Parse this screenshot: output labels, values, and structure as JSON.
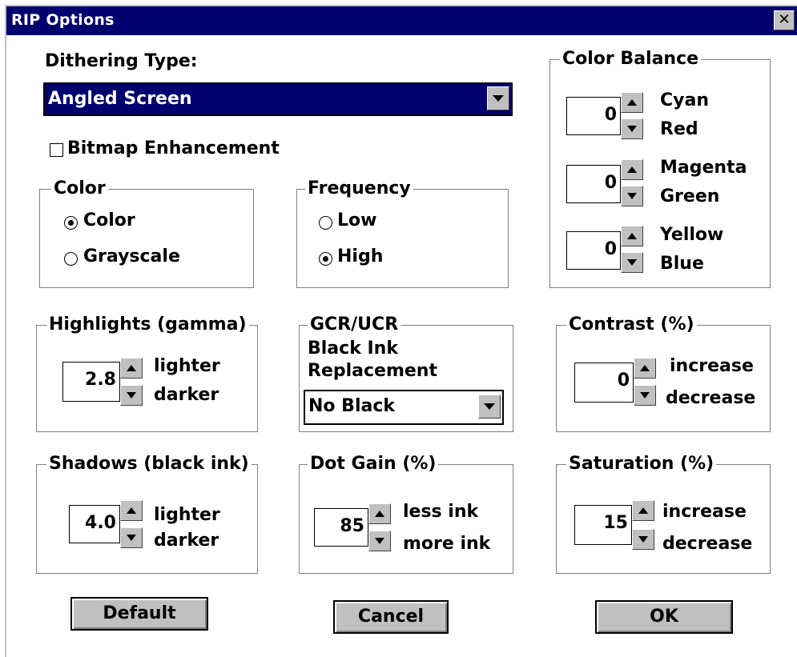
{
  "window": {
    "title": "RIP Options",
    "close_glyph": "✕"
  },
  "dithering": {
    "label": "Dithering Type:",
    "selected": "Angled Screen",
    "arrow_icon": "chevron-down-icon"
  },
  "bitmap": {
    "label": "Bitmap Enhancement",
    "checked": false
  },
  "color_group": {
    "title": "Color",
    "options": [
      {
        "label": "Color",
        "selected": true
      },
      {
        "label": "Grayscale",
        "selected": false
      }
    ]
  },
  "frequency_group": {
    "title": "Frequency",
    "options": [
      {
        "label": "Low",
        "selected": false
      },
      {
        "label": "High",
        "selected": true
      }
    ]
  },
  "color_balance": {
    "title": "Color Balance",
    "rows": [
      {
        "value": "0",
        "up": "Cyan",
        "down": "Red"
      },
      {
        "value": "0",
        "up": "Magenta",
        "down": "Green"
      },
      {
        "value": "0",
        "up": "Yellow",
        "down": "Blue"
      }
    ]
  },
  "highlights": {
    "title": "Highlights (gamma)",
    "value": "2.8",
    "up": "lighter",
    "down": "darker"
  },
  "gcr": {
    "title": "GCR/UCR",
    "line1": "Black Ink",
    "line2": "Replacement",
    "selected": "No Black"
  },
  "contrast": {
    "title": "Contrast (%)",
    "value": "0",
    "up": "increase",
    "down": "decrease"
  },
  "shadows": {
    "title": "Shadows (black ink)",
    "value": "4.0",
    "up": "lighter",
    "down": "darker"
  },
  "dot_gain": {
    "title": "Dot Gain (%)",
    "value": "85",
    "up": "less ink",
    "down": "more ink"
  },
  "saturation": {
    "title": "Saturation (%)",
    "value": "15",
    "up": "increase",
    "down": "decrease"
  },
  "buttons": {
    "default": "Default",
    "cancel": "Cancel",
    "ok": "OK"
  },
  "colors": {
    "titlebar": "#00006e",
    "face": "#c0c0c0",
    "selection": "#00006e"
  }
}
